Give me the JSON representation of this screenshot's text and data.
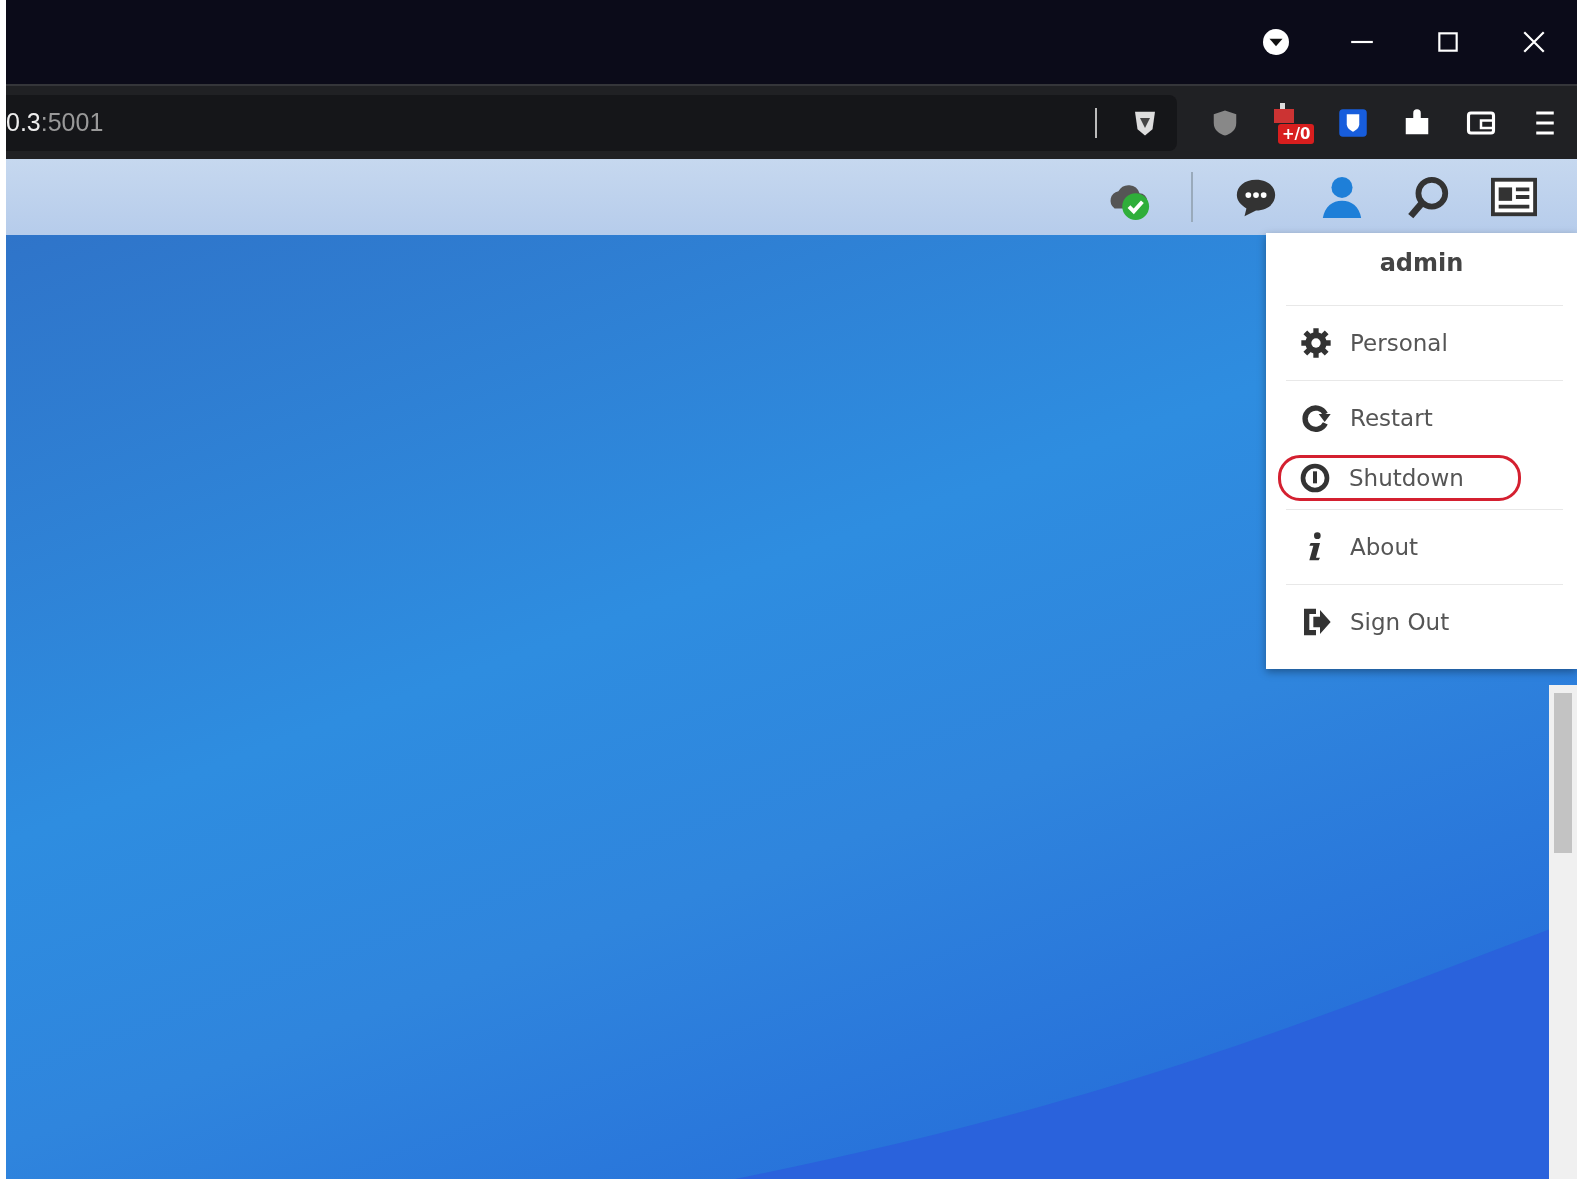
{
  "browser": {
    "address": {
      "host": "0.3",
      "port": ":5001"
    },
    "extension_badge": "+/0"
  },
  "user_menu": {
    "user": "admin",
    "items": [
      {
        "kind": "gear",
        "label": "Personal",
        "highlighted": false
      },
      {
        "kind": "restart",
        "label": "Restart",
        "highlighted": false
      },
      {
        "kind": "power",
        "label": "Shutdown",
        "highlighted": true
      },
      {
        "kind": "info",
        "label": "About",
        "highlighted": false
      },
      {
        "kind": "signout",
        "label": "Sign Out",
        "highlighted": false
      }
    ]
  }
}
